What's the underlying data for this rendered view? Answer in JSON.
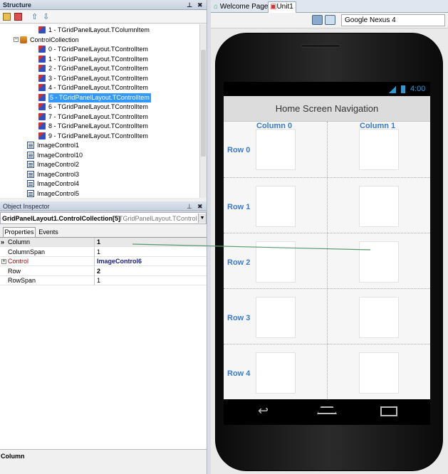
{
  "structure": {
    "title": "Structure",
    "items": [
      {
        "label": "1 - TGridPanelLayout.TColumnItem",
        "kind": "cls"
      },
      {
        "label": "ControlCollection",
        "kind": "coll"
      },
      {
        "label": "0 - TGridPanelLayout.TControlItem",
        "kind": "cls"
      },
      {
        "label": "1 - TGridPanelLayout.TControlItem",
        "kind": "cls"
      },
      {
        "label": "2 - TGridPanelLayout.TControlItem",
        "kind": "cls"
      },
      {
        "label": "3 - TGridPanelLayout.TControlItem",
        "kind": "cls"
      },
      {
        "label": "4 - TGridPanelLayout.TControlItem",
        "kind": "cls"
      },
      {
        "label": "5 - TGridPanelLayout.TControlItem",
        "kind": "cls",
        "selected": true
      },
      {
        "label": "6 - TGridPanelLayout.TControlItem",
        "kind": "cls"
      },
      {
        "label": "7 - TGridPanelLayout.TControlItem",
        "kind": "cls"
      },
      {
        "label": "8 - TGridPanelLayout.TControlItem",
        "kind": "cls"
      },
      {
        "label": "9 - TGridPanelLayout.TControlItem",
        "kind": "cls"
      },
      {
        "label": "ImageControl1",
        "kind": "img"
      },
      {
        "label": "ImageControl10",
        "kind": "img"
      },
      {
        "label": "ImageControl2",
        "kind": "img"
      },
      {
        "label": "ImageControl3",
        "kind": "img"
      },
      {
        "label": "ImageControl4",
        "kind": "img"
      },
      {
        "label": "ImageControl5",
        "kind": "img"
      }
    ]
  },
  "inspector": {
    "title": "Object Inspector",
    "object_name": "GridPanelLayout1.ControlCollection[5]",
    "object_type": "TGridPanelLayout.TControlIt",
    "tabs": [
      "Properties",
      "Events"
    ],
    "props": [
      {
        "key": "Column",
        "value": "1",
        "bold": true
      },
      {
        "key": "ColumnSpan",
        "value": "1",
        "bold": false
      },
      {
        "key": "Control",
        "value": "ImageControl6",
        "bold": true,
        "expandable": true
      },
      {
        "key": "Row",
        "value": "2",
        "bold": true
      },
      {
        "key": "RowSpan",
        "value": "1",
        "bold": false
      }
    ],
    "status": "Column"
  },
  "tabs": {
    "welcome": "Welcome Page",
    "unit": "Unit1"
  },
  "device": "Google Nexus 4",
  "phone": {
    "time": "4:00",
    "header": "Home Screen Navigation",
    "columns": [
      "Column 0",
      "Column 1"
    ],
    "rows": [
      "Row 0",
      "Row 1",
      "Row 2",
      "Row 3",
      "Row 4"
    ]
  },
  "colors": {
    "accent": "#3a7cc8",
    "selection": "#3399ff"
  }
}
